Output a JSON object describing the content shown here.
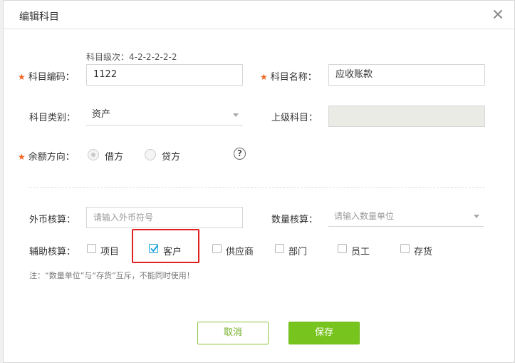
{
  "dialog": {
    "title": "编辑科目"
  },
  "form": {
    "level_hint": "科目级次：4-2-2-2-2-2",
    "code": {
      "label": "科目编码：",
      "value": "1122",
      "required": true
    },
    "name": {
      "label": "科目名称：",
      "value": "应收账款",
      "required": true
    },
    "category": {
      "label": "科目类别：",
      "value": "资产"
    },
    "parent": {
      "label": "上级科目：",
      "value": ""
    },
    "balance_direction": {
      "label": "余额方向：",
      "required": true,
      "options": [
        {
          "label": "借方",
          "selected": true
        },
        {
          "label": "贷方",
          "selected": false
        }
      ]
    },
    "help_icon": "question-circle-icon",
    "currency": {
      "label": "外币核算：",
      "placeholder": "请输入外币符号"
    },
    "quantity": {
      "label": "数量核算：",
      "placeholder": "请输入数量单位"
    },
    "auxiliary": {
      "label": "辅助核算：",
      "options": [
        {
          "label": "项目",
          "checked": false
        },
        {
          "label": "客户",
          "checked": true
        },
        {
          "label": "供应商",
          "checked": false
        },
        {
          "label": "部门",
          "checked": false
        },
        {
          "label": "员工",
          "checked": false
        },
        {
          "label": "存货",
          "checked": false
        }
      ]
    },
    "note": "注：“数量单位”与“存货”互斥，不能同时使用！"
  },
  "buttons": {
    "cancel": "取消",
    "save": "保存"
  },
  "colors": {
    "accent_green": "#78c41e",
    "required_star": "#f26522",
    "highlight_red": "#e02020",
    "checkbox_blue": "#1aa0d8"
  }
}
